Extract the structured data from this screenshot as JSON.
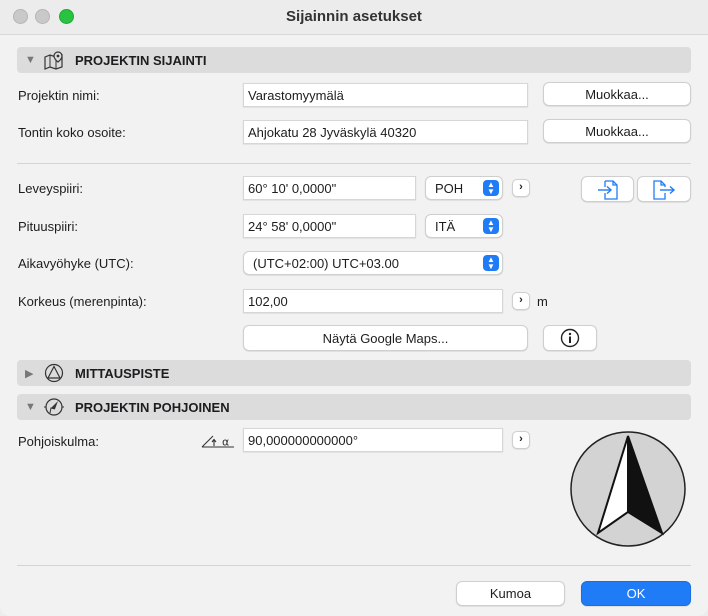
{
  "window": {
    "title": "Sijainnin asetukset"
  },
  "sections": {
    "location": {
      "title": "PROJEKTIN SIJAINTI",
      "icon": "map-pin-icon",
      "expanded": true
    },
    "survey": {
      "title": "MITTAUSPISTE",
      "icon": "survey-point-icon",
      "expanded": false
    },
    "north": {
      "title": "PROJEKTIN POHJOINEN",
      "icon": "compass-icon",
      "expanded": true
    }
  },
  "project_name": {
    "label": "Projektin nimi:",
    "value": "Varastomyymälä",
    "edit_label": "Muokkaa..."
  },
  "address": {
    "label": "Tontin koko osoite:",
    "value": "Ahjokatu 28 Jyväskylä 40320",
    "edit_label": "Muokkaa..."
  },
  "latitude": {
    "label": "Leveyspiiri:",
    "value": "60° 10' 0,0000\"",
    "direction": "POH"
  },
  "longitude": {
    "label": "Pituuspiiri:",
    "value": "24° 58' 0,0000\"",
    "direction": "ITÄ"
  },
  "timezone": {
    "label": "Aikavyöhyke (UTC):",
    "value": "(UTC+02:00) UTC+03.00"
  },
  "elevation": {
    "label": "Korkeus (merenpinta):",
    "value": "102,00",
    "unit": "m"
  },
  "google_maps_label": "Näytä Google Maps...",
  "north_angle": {
    "label": "Pohjoiskulma:",
    "value": "90,000000000000°",
    "icon": "angle-icon"
  },
  "footer": {
    "cancel_label": "Kumoa",
    "ok_label": "OK"
  },
  "colors": {
    "accent": "#1f7cf6",
    "section_bg": "#dcdcdc",
    "window_bg": "#f2f2f2"
  }
}
